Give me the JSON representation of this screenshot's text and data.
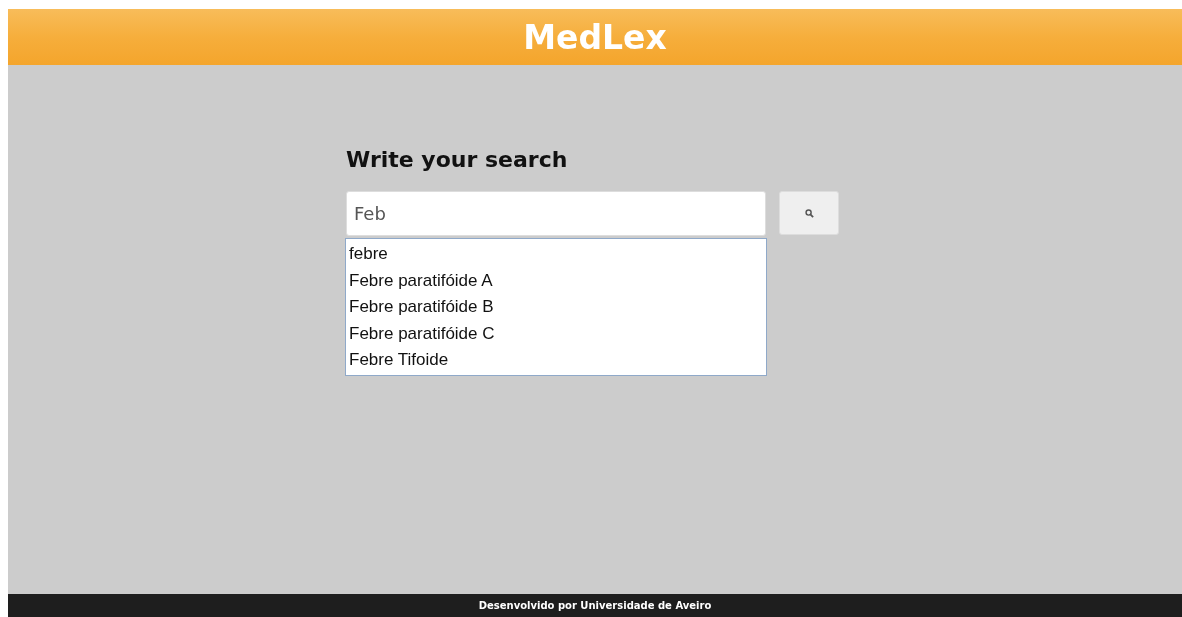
{
  "header": {
    "title": "MedLex"
  },
  "search": {
    "heading": "Write your search",
    "value": "Feb"
  },
  "suggestions": [
    {
      "label": "febre"
    },
    {
      "label": "Febre paratifóide A"
    },
    {
      "label": "Febre paratifóide B"
    },
    {
      "label": "Febre paratifóide C"
    },
    {
      "label": "Febre Tifoide"
    }
  ],
  "footer": {
    "text": "Desenvolvido por Universidade de Aveiro"
  }
}
